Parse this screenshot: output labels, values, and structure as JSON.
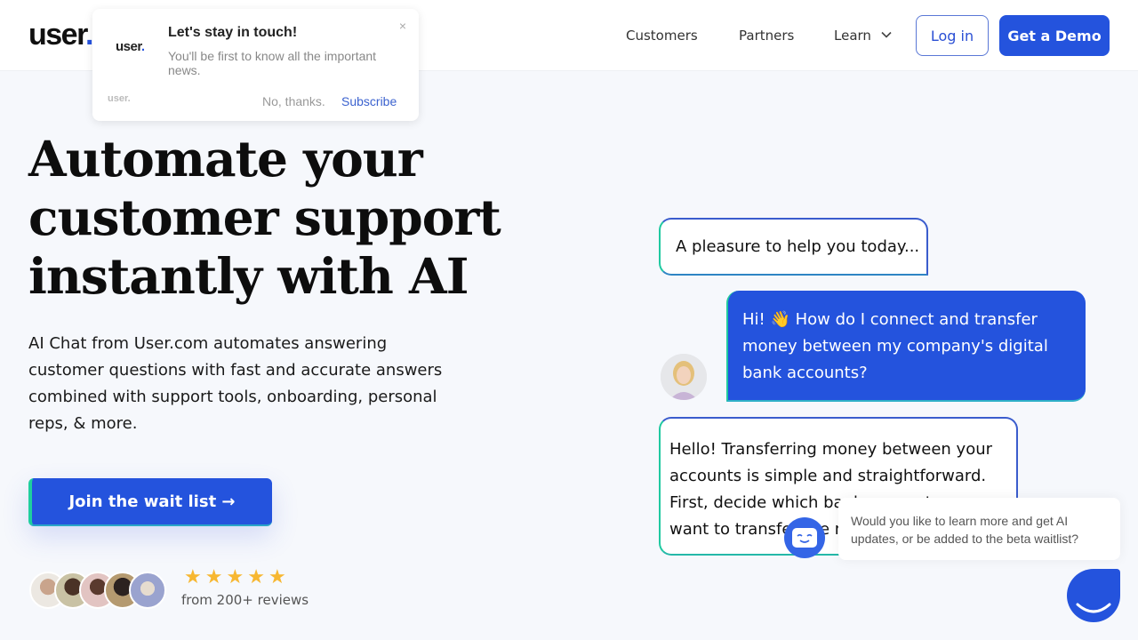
{
  "header": {
    "logo_text": "user",
    "logo_dot": ".",
    "nav": [
      {
        "label": "Customers"
      },
      {
        "label": "Partners"
      },
      {
        "label": "Learn"
      }
    ],
    "login_label": "Log in",
    "demo_label": "Get a Demo"
  },
  "popup": {
    "logo_text": "user",
    "logo_dot": ".",
    "title": "Let's stay in touch!",
    "text": "You'll be first to know all the important news.",
    "close": "×",
    "brand": "user.",
    "decline_label": "No, thanks.",
    "subscribe_label": "Subscribe"
  },
  "hero": {
    "title": "Automate your customer support instantly with AI",
    "subtitle": "AI Chat from User.com automates answering customer questions with fast and accurate answers combined with support tools, onboarding, personal reps, & more.",
    "cta_label": "Join the wait list →",
    "rating_stars": 5,
    "star_glyph": "★",
    "reviews_text": "from 200+ reviews"
  },
  "chat": {
    "bot_greeting": "A pleasure to help you today...",
    "user_message": "Hi! 👋 How do I connect and transfer money between my company's digital bank accounts?",
    "bot_reply": "Hello! Transferring money between your accounts is simple and straightforward. First, decide which bank account you want to transfer the money from"
  },
  "widget": {
    "message": "Would you like to learn more and get AI updates, or be added to the beta waitlist?"
  },
  "colors": {
    "accent": "#2453dd",
    "accent_gradient_start": "#1fc9a0",
    "star": "#f7b731",
    "background": "#f6f8fc"
  }
}
